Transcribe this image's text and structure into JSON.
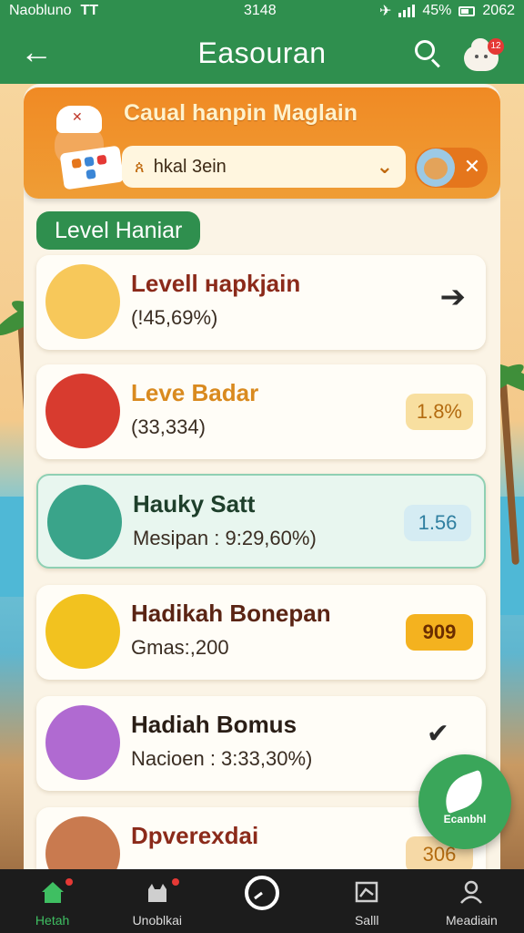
{
  "status_bar": {
    "carrier": "Naobluno",
    "network": "TT",
    "time": "3148",
    "battery": "45%",
    "extra": "2062"
  },
  "header": {
    "back_icon": "←",
    "title": "Easouran",
    "notification_count": "12"
  },
  "banner": {
    "title": "Caual hanpin Maglain",
    "search_value": "hkal 3ein",
    "close_icon": "✕"
  },
  "section": {
    "title": "Level Haniar"
  },
  "items": [
    {
      "name": "Levell нaрkjain",
      "sub": "(!45,69%)",
      "badge": "",
      "name_color": "#8b2a1a",
      "icon": "basket-icon"
    },
    {
      "name": "Leve Badar",
      "sub": "(33,334)",
      "badge": "1.8%",
      "name_color": "#d98a1f",
      "badge_bg": "#f8dfa0",
      "badge_fg": "#b36b10",
      "icon": "person-icon"
    },
    {
      "name": "Hauky Satt",
      "sub": "Mesipan : 9:29,60%)",
      "badge": "1.56",
      "name_color": "#1e3f2b",
      "badge_bg": "#d5ecf3",
      "badge_fg": "#2f7fa0",
      "icon": "gift-basket-icon"
    },
    {
      "name": "Hadikah Bonepan",
      "sub": "Gmas:,200",
      "badge": "909",
      "name_color": "#5a2414",
      "badge_bg": "#f4b21f",
      "badge_fg": "#6b2d00",
      "icon": "cat-icon"
    },
    {
      "name": "Hadiah Bomus",
      "sub": "Nacioen : 3:33,30%)",
      "badge": "",
      "name_color": "#2a1e16",
      "icon": "bonus-icon"
    },
    {
      "name": "Dpverexdai",
      "sub": "",
      "badge": "306",
      "name_color": "#8b2a1a",
      "badge_bg": "#f6d9a6",
      "badge_fg": "#b36b10",
      "icon": "cat-icon"
    }
  ],
  "fab": {
    "label": "Ecanbhl"
  },
  "bottom_nav": [
    {
      "label": "Hetah",
      "icon": "home-icon",
      "active": true
    },
    {
      "label": "Unoblkai",
      "icon": "cat-icon",
      "active": false
    },
    {
      "label": "",
      "icon": "clock-icon",
      "active": false
    },
    {
      "label": "Salll",
      "icon": "map-icon",
      "active": false
    },
    {
      "label": "Meadiain",
      "icon": "profile-icon",
      "active": false
    }
  ]
}
